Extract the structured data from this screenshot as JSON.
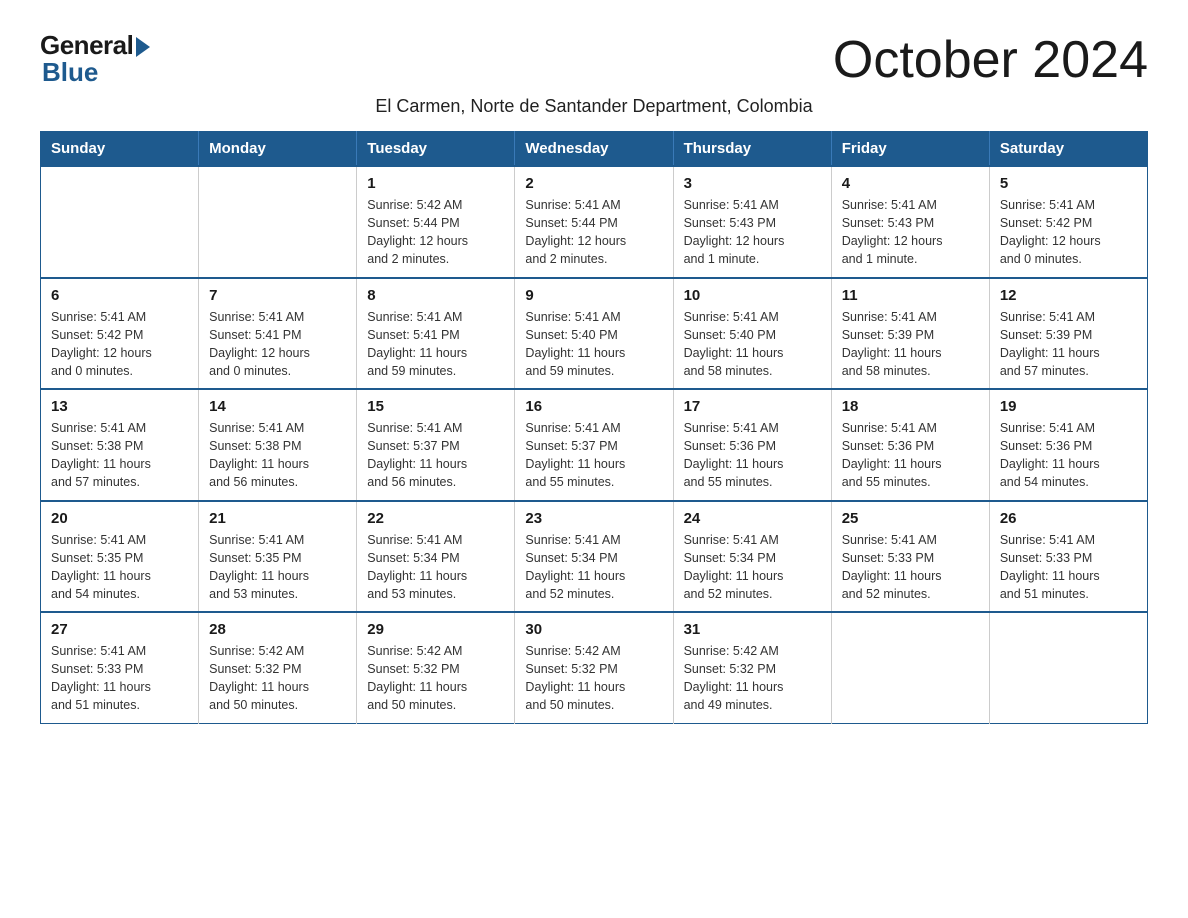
{
  "logo": {
    "general": "General",
    "blue": "Blue"
  },
  "title": "October 2024",
  "subtitle": "El Carmen, Norte de Santander Department, Colombia",
  "weekdays": [
    "Sunday",
    "Monday",
    "Tuesday",
    "Wednesday",
    "Thursday",
    "Friday",
    "Saturday"
  ],
  "weeks": [
    [
      {
        "day": "",
        "info": ""
      },
      {
        "day": "",
        "info": ""
      },
      {
        "day": "1",
        "info": "Sunrise: 5:42 AM\nSunset: 5:44 PM\nDaylight: 12 hours\nand 2 minutes."
      },
      {
        "day": "2",
        "info": "Sunrise: 5:41 AM\nSunset: 5:44 PM\nDaylight: 12 hours\nand 2 minutes."
      },
      {
        "day": "3",
        "info": "Sunrise: 5:41 AM\nSunset: 5:43 PM\nDaylight: 12 hours\nand 1 minute."
      },
      {
        "day": "4",
        "info": "Sunrise: 5:41 AM\nSunset: 5:43 PM\nDaylight: 12 hours\nand 1 minute."
      },
      {
        "day": "5",
        "info": "Sunrise: 5:41 AM\nSunset: 5:42 PM\nDaylight: 12 hours\nand 0 minutes."
      }
    ],
    [
      {
        "day": "6",
        "info": "Sunrise: 5:41 AM\nSunset: 5:42 PM\nDaylight: 12 hours\nand 0 minutes."
      },
      {
        "day": "7",
        "info": "Sunrise: 5:41 AM\nSunset: 5:41 PM\nDaylight: 12 hours\nand 0 minutes."
      },
      {
        "day": "8",
        "info": "Sunrise: 5:41 AM\nSunset: 5:41 PM\nDaylight: 11 hours\nand 59 minutes."
      },
      {
        "day": "9",
        "info": "Sunrise: 5:41 AM\nSunset: 5:40 PM\nDaylight: 11 hours\nand 59 minutes."
      },
      {
        "day": "10",
        "info": "Sunrise: 5:41 AM\nSunset: 5:40 PM\nDaylight: 11 hours\nand 58 minutes."
      },
      {
        "day": "11",
        "info": "Sunrise: 5:41 AM\nSunset: 5:39 PM\nDaylight: 11 hours\nand 58 minutes."
      },
      {
        "day": "12",
        "info": "Sunrise: 5:41 AM\nSunset: 5:39 PM\nDaylight: 11 hours\nand 57 minutes."
      }
    ],
    [
      {
        "day": "13",
        "info": "Sunrise: 5:41 AM\nSunset: 5:38 PM\nDaylight: 11 hours\nand 57 minutes."
      },
      {
        "day": "14",
        "info": "Sunrise: 5:41 AM\nSunset: 5:38 PM\nDaylight: 11 hours\nand 56 minutes."
      },
      {
        "day": "15",
        "info": "Sunrise: 5:41 AM\nSunset: 5:37 PM\nDaylight: 11 hours\nand 56 minutes."
      },
      {
        "day": "16",
        "info": "Sunrise: 5:41 AM\nSunset: 5:37 PM\nDaylight: 11 hours\nand 55 minutes."
      },
      {
        "day": "17",
        "info": "Sunrise: 5:41 AM\nSunset: 5:36 PM\nDaylight: 11 hours\nand 55 minutes."
      },
      {
        "day": "18",
        "info": "Sunrise: 5:41 AM\nSunset: 5:36 PM\nDaylight: 11 hours\nand 55 minutes."
      },
      {
        "day": "19",
        "info": "Sunrise: 5:41 AM\nSunset: 5:36 PM\nDaylight: 11 hours\nand 54 minutes."
      }
    ],
    [
      {
        "day": "20",
        "info": "Sunrise: 5:41 AM\nSunset: 5:35 PM\nDaylight: 11 hours\nand 54 minutes."
      },
      {
        "day": "21",
        "info": "Sunrise: 5:41 AM\nSunset: 5:35 PM\nDaylight: 11 hours\nand 53 minutes."
      },
      {
        "day": "22",
        "info": "Sunrise: 5:41 AM\nSunset: 5:34 PM\nDaylight: 11 hours\nand 53 minutes."
      },
      {
        "day": "23",
        "info": "Sunrise: 5:41 AM\nSunset: 5:34 PM\nDaylight: 11 hours\nand 52 minutes."
      },
      {
        "day": "24",
        "info": "Sunrise: 5:41 AM\nSunset: 5:34 PM\nDaylight: 11 hours\nand 52 minutes."
      },
      {
        "day": "25",
        "info": "Sunrise: 5:41 AM\nSunset: 5:33 PM\nDaylight: 11 hours\nand 52 minutes."
      },
      {
        "day": "26",
        "info": "Sunrise: 5:41 AM\nSunset: 5:33 PM\nDaylight: 11 hours\nand 51 minutes."
      }
    ],
    [
      {
        "day": "27",
        "info": "Sunrise: 5:41 AM\nSunset: 5:33 PM\nDaylight: 11 hours\nand 51 minutes."
      },
      {
        "day": "28",
        "info": "Sunrise: 5:42 AM\nSunset: 5:32 PM\nDaylight: 11 hours\nand 50 minutes."
      },
      {
        "day": "29",
        "info": "Sunrise: 5:42 AM\nSunset: 5:32 PM\nDaylight: 11 hours\nand 50 minutes."
      },
      {
        "day": "30",
        "info": "Sunrise: 5:42 AM\nSunset: 5:32 PM\nDaylight: 11 hours\nand 50 minutes."
      },
      {
        "day": "31",
        "info": "Sunrise: 5:42 AM\nSunset: 5:32 PM\nDaylight: 11 hours\nand 49 minutes."
      },
      {
        "day": "",
        "info": ""
      },
      {
        "day": "",
        "info": ""
      }
    ]
  ]
}
